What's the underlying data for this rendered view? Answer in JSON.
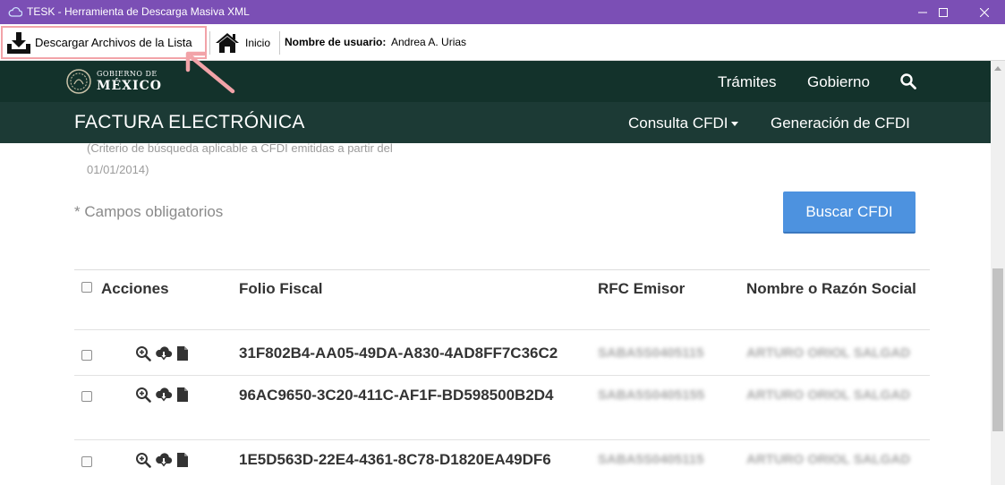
{
  "window": {
    "title": "TESK - Herramienta de Descarga Masiva XML",
    "accent_color": "#7b4fb5"
  },
  "toolbar": {
    "download_label": "Descargar Archivos de la Lista",
    "home_label": "Inicio",
    "user_label": "Nombre de usuario:",
    "user_value": "Andrea A. Urias"
  },
  "gob": {
    "logo_small": "GOBIERNO DE",
    "logo_big": "MÉXICO",
    "nav": [
      "Trámites",
      "Gobierno"
    ],
    "bg_color": "#13322b"
  },
  "fe": {
    "title": "FACTURA ELECTRÓNICA",
    "nav_consulta": "Consulta CFDI",
    "nav_generacion": "Generación de CFDI"
  },
  "form": {
    "criteria_note_1": "(Criterio de búsqueda aplicable a CFDI emitidas a partir del",
    "criteria_note_2": "01/01/2014)",
    "required_note": "* Campos obligatorios",
    "search_button": "Buscar CFDI",
    "button_color": "#4d92df"
  },
  "table": {
    "headers": [
      "Acciones",
      "Folio Fiscal",
      "RFC Emisor",
      "Nombre o Razón Social"
    ],
    "rows": [
      {
        "folio": "31F802B4-AA05-49DA-A830-4AD8FF7C36C2",
        "rfc": "SABA5S0405115",
        "nombre": "ARTURO ORIOL SALGAD"
      },
      {
        "folio": "96AC9650-3C20-411C-AF1F-BD598500B2D4",
        "rfc": "SABA5S0405155",
        "nombre": "ARTURO ORIOL SALGAD"
      },
      {
        "folio": "1E5D563D-22E4-4361-8C78-D1820EA49DF6",
        "rfc": "SABA5S0405115",
        "nombre": "ARTURO ORIOL SALGAD"
      }
    ]
  }
}
